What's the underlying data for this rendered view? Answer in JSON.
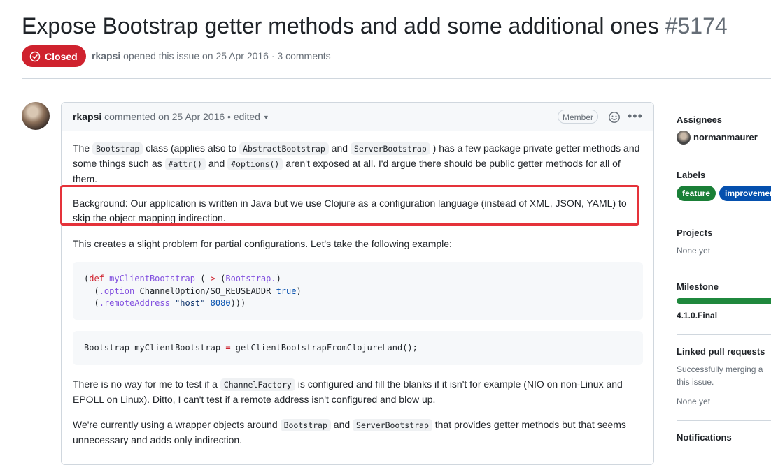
{
  "issue": {
    "title": "Expose Bootstrap getter methods and add some additional ones",
    "number": "#5174",
    "state": "Closed",
    "author": "rkapsi",
    "opened_text": "opened this issue on 25 Apr 2016 · 3 comments"
  },
  "comment": {
    "author": "rkapsi",
    "meta": "commented on 25 Apr 2016 • edited",
    "role_badge": "Member",
    "p1": {
      "t1": "The ",
      "c1": "Bootstrap",
      "t2": " class (applies also to ",
      "c2": "AbstractBootstrap",
      "t3": " and ",
      "c3": "ServerBootstrap",
      "t4": " ) has a few package private getter methods and some things such as ",
      "c4": "#attr()",
      "t5": " and ",
      "c5": "#options()",
      "t6": " aren't exposed at all. I'd argue there should be public getter methods for all of them."
    },
    "p2": "Background: Our application is written in Java but we use Clojure as a configuration language (instead of XML, JSON, YAML) to skip the object mapping indirection.",
    "p3": "This creates a slight problem for partial configurations. Let's take the following example:",
    "code1": {
      "l1_open": "(",
      "l1_def": "def",
      "l1_name": "myClientBootstrap",
      "l1_arrow": "->",
      "l1_ctor": "Bootstrap.",
      "l2_method": ".option",
      "l2_arg": "ChannelOption/SO_REUSEADDR",
      "l2_val": "true",
      "l3_method": ".remoteAddress",
      "l3_str": "\"host\"",
      "l3_num": "8080"
    },
    "code2": {
      "type": "Bootstrap",
      "var": "myClientBootstrap",
      "eq": "=",
      "call": "getClientBootstrapFromClojureLand();"
    },
    "p4": {
      "t1": "There is no way for me to test if a ",
      "c1": "ChannelFactory",
      "t2": " is configured and fill the blanks if it isn't for example (NIO on non-Linux and EPOLL on Linux). Ditto, I can't test if a remote address isn't configured and blow up."
    },
    "p5": {
      "t1": "We're currently using a wrapper objects around ",
      "c1": "Bootstrap",
      "t2": " and ",
      "c2": "ServerBootstrap",
      "t3": " that provides getter methods but that seems unnecessary and adds only indirection."
    }
  },
  "sidebar": {
    "assignees_title": "Assignees",
    "assignee": "normanmaurer",
    "labels_title": "Labels",
    "labels": [
      {
        "name": "feature",
        "color": "#1a7f37"
      },
      {
        "name": "improvement",
        "color": "#0550ae"
      }
    ],
    "projects_title": "Projects",
    "projects_value": "None yet",
    "milestone_title": "Milestone",
    "milestone_progress_pct": 100,
    "milestone_value": "4.1.0.Final",
    "linked_title": "Linked pull requests",
    "linked_text_1": "Successfully merging a",
    "linked_text_2": "this issue.",
    "linked_value": "None yet",
    "notifications_title": "Notifications"
  },
  "colors": {
    "closed_badge": "#cf222e",
    "highlight_border": "#e5323a",
    "milestone_bar": "#1f883d"
  }
}
